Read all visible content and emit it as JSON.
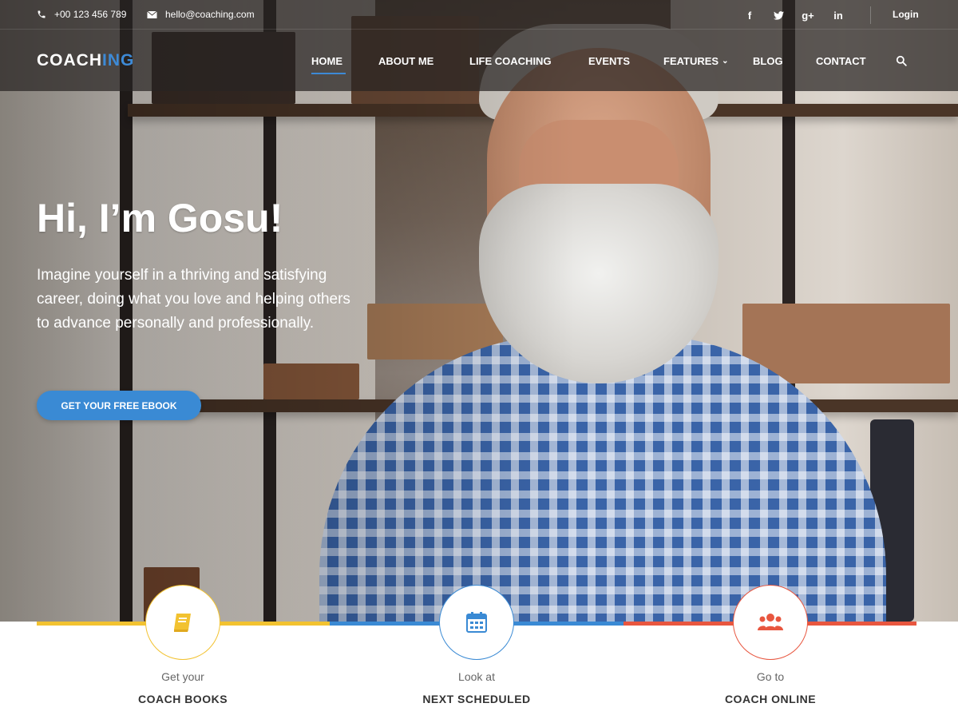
{
  "topbar": {
    "phone": "+00 123 456 789",
    "email": "hello@coaching.com",
    "login_label": "Login",
    "social": [
      {
        "icon": "facebook-icon",
        "glyph": "f"
      },
      {
        "icon": "twitter-icon",
        "glyph": ""
      },
      {
        "icon": "google-plus-icon",
        "glyph": "g+"
      },
      {
        "icon": "linkedin-icon",
        "glyph": "in"
      }
    ]
  },
  "logo": {
    "part1": "COACH",
    "part2": "ING"
  },
  "nav": {
    "items": [
      {
        "label": "HOME",
        "active": true
      },
      {
        "label": "ABOUT ME"
      },
      {
        "label": "LIFE COACHING"
      },
      {
        "label": "EVENTS"
      },
      {
        "label": "FEATURES",
        "has_dropdown": true
      },
      {
        "label": "BLOG"
      },
      {
        "label": "CONTACT"
      }
    ]
  },
  "hero": {
    "title": "Hi, I’m Gosu!",
    "text": "Imagine yourself in a thriving and satisfying career, doing what you love and helping others to advance personally and professionally.",
    "cta_label": "GET YOUR FREE EBOOK"
  },
  "features": [
    {
      "small": "Get your",
      "big": "COACH BOOKS",
      "color": "#f2c230",
      "icon": "book-icon"
    },
    {
      "small": "Look at",
      "big": "NEXT SCHEDULED",
      "color": "#3a8ad4",
      "icon": "calendar-icon"
    },
    {
      "small": "Go to",
      "big": "COACH ONLINE",
      "color": "#e8563f",
      "icon": "users-icon"
    }
  ],
  "colors": {
    "accent": "#3d8ad6",
    "header_bg": "#282422"
  }
}
